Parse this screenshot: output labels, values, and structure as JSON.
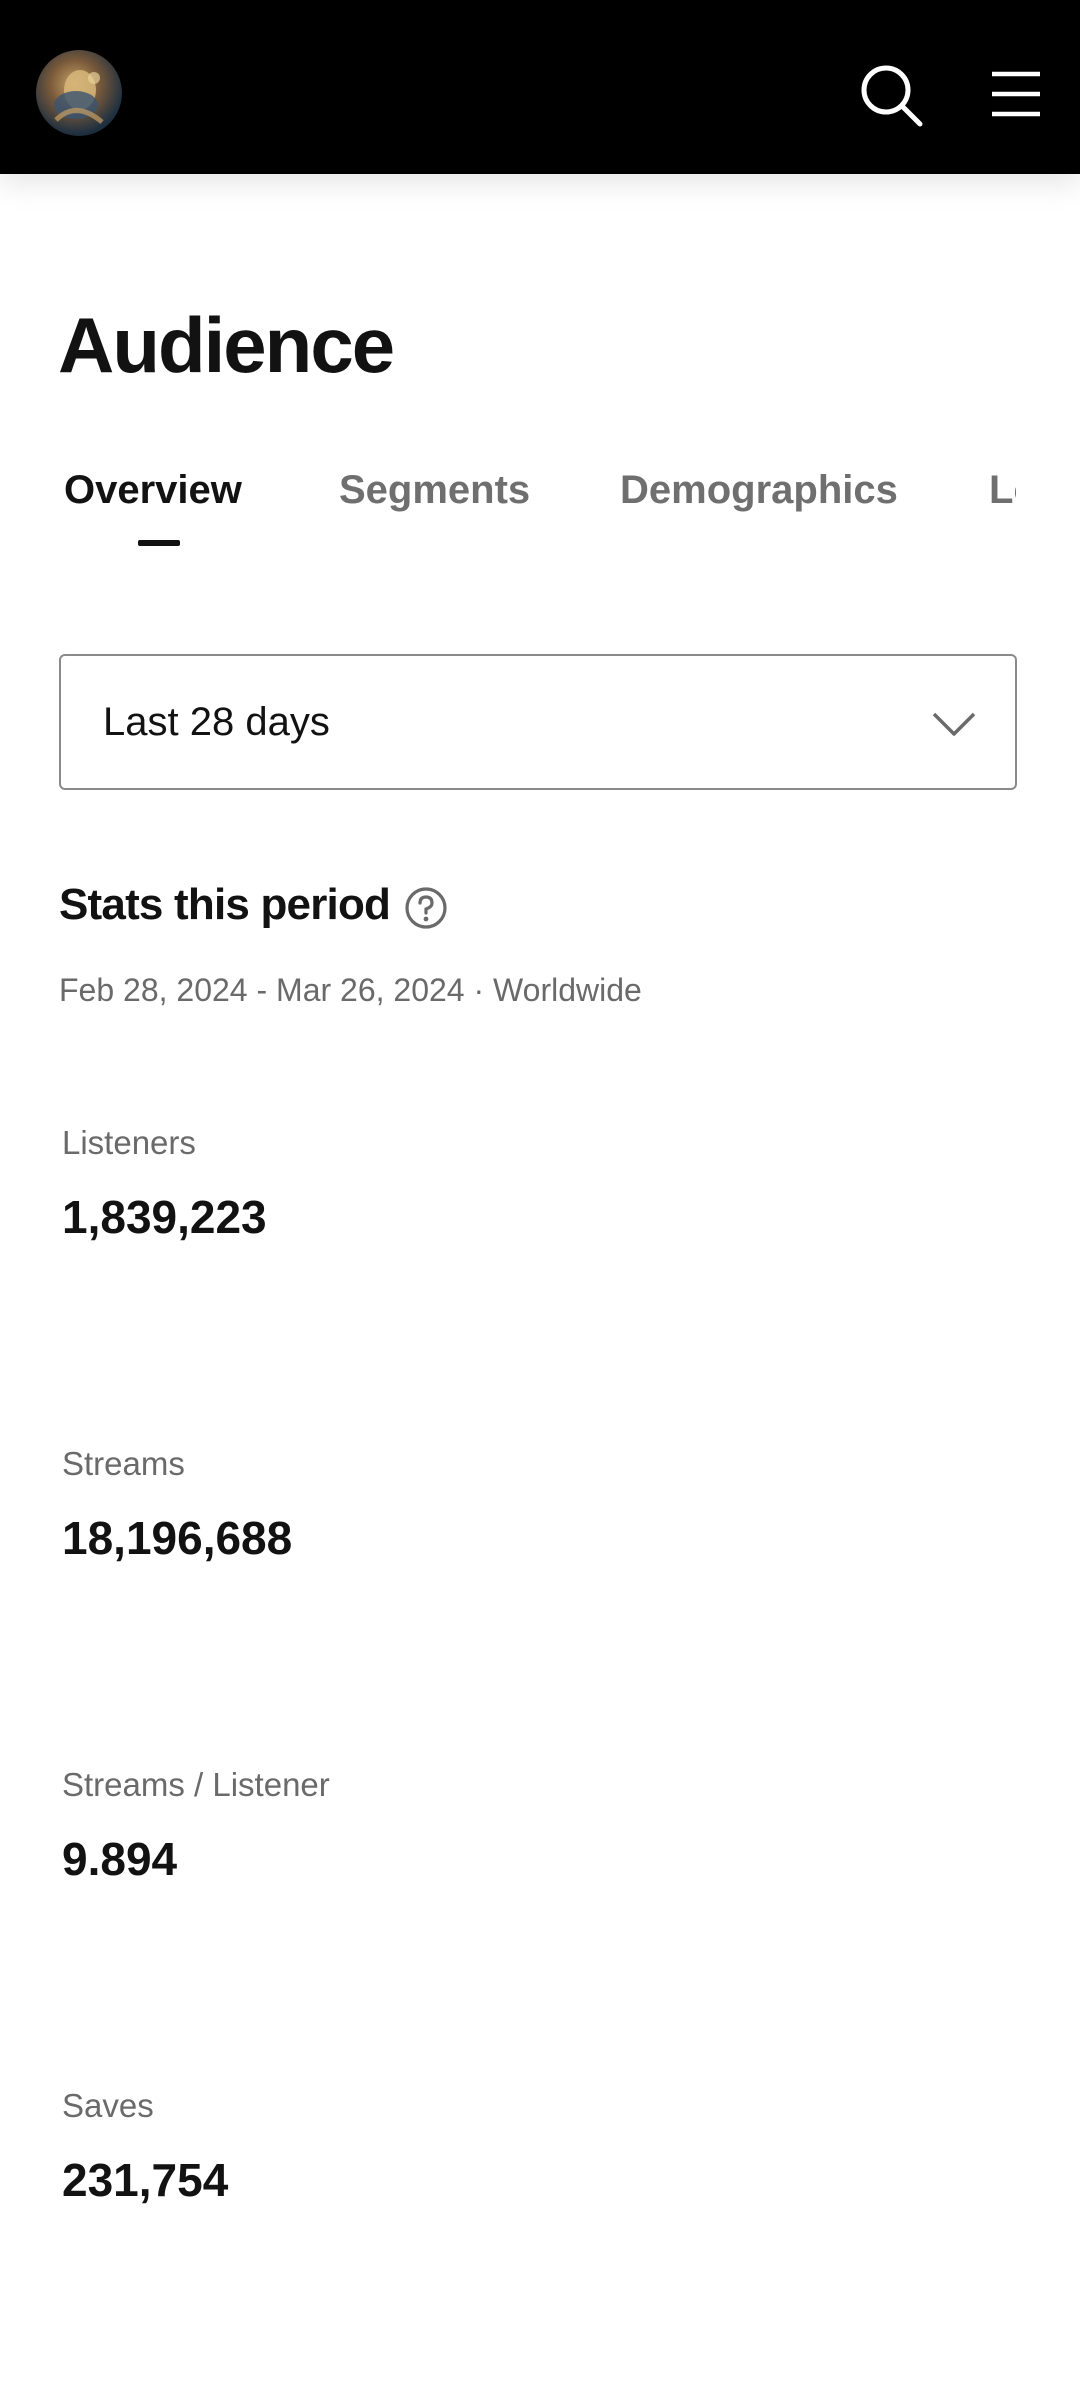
{
  "header": {
    "avatar_icon": "artist-avatar",
    "search_icon": "search-icon",
    "menu_icon": "hamburger-menu-icon",
    "background": "#000000"
  },
  "page": {
    "title": "Audience"
  },
  "tabs": [
    {
      "label": "Overview",
      "active": true
    },
    {
      "label": "Segments",
      "active": false
    },
    {
      "label": "Demographics",
      "active": false
    },
    {
      "label": "Lo",
      "active": false
    }
  ],
  "date_range": {
    "selected": "Last 28 days"
  },
  "stats": {
    "section_title": "Stats this period",
    "period": "Feb 28, 2024 - Mar 26, 2024 · Worldwide",
    "items": [
      {
        "label": "Listeners",
        "value": "1,839,223"
      },
      {
        "label": "Streams",
        "value": "18,196,688"
      },
      {
        "label": "Streams / Listener",
        "value": "9.894"
      },
      {
        "label": "Saves",
        "value": "231,754"
      }
    ]
  }
}
